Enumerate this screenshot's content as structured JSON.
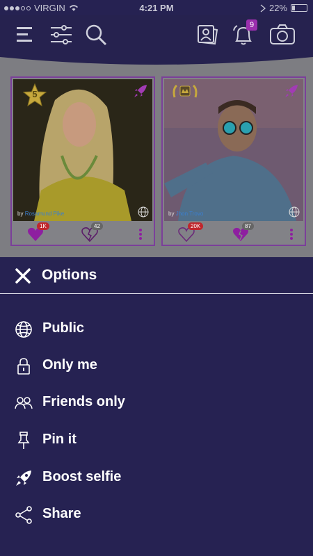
{
  "status_bar": {
    "carrier": "VIRGIN",
    "time": "4:21 PM",
    "battery": "22%"
  },
  "app_bar": {
    "notification_count": "9"
  },
  "cards": [
    {
      "rank": "5",
      "by_prefix": "by",
      "author": "Rosamund Pike",
      "likes": "1K",
      "broken_hearts": "42"
    },
    {
      "by_prefix": "by",
      "author": "Jhon Trovo",
      "likes": "20K",
      "broken_hearts": "87"
    }
  ],
  "options": {
    "title": "Options",
    "items": [
      {
        "label": "Public",
        "icon": "globe-icon"
      },
      {
        "label": "Only me",
        "icon": "lock-icon"
      },
      {
        "label": "Friends only",
        "icon": "friends-icon"
      },
      {
        "label": "Pin it",
        "icon": "pin-icon"
      },
      {
        "label": "Boost selfie",
        "icon": "rocket-icon"
      },
      {
        "label": "Share",
        "icon": "share-icon"
      }
    ]
  },
  "colors": {
    "sheet_bg": "#262252",
    "accent_purple": "#9b2fae",
    "badge_red": "#c0262c"
  }
}
